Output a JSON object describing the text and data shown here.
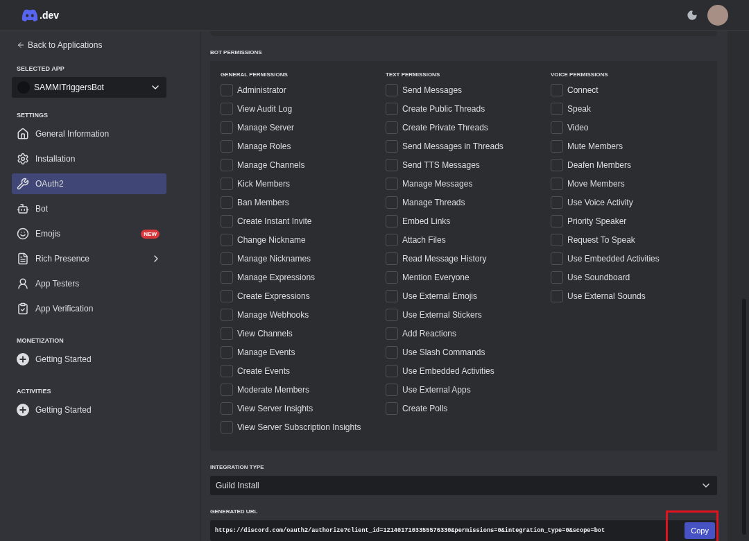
{
  "header": {
    "logo_text": ".dev"
  },
  "sidebar": {
    "back_link": "Back to Applications",
    "selected_app_label": "SELECTED APP",
    "selected_app": "SAMMITriggersBot",
    "sections": [
      {
        "title": "SETTINGS",
        "items": [
          {
            "label": "General Information",
            "selected": false,
            "submenu": false
          },
          {
            "label": "Installation",
            "selected": false,
            "submenu": false
          },
          {
            "label": "OAuth2",
            "selected": true,
            "submenu": false
          },
          {
            "label": "Bot",
            "selected": false,
            "submenu": false
          },
          {
            "label": "Emojis",
            "selected": false,
            "submenu": false,
            "badge": "NEW"
          },
          {
            "label": "Rich Presence",
            "selected": false,
            "submenu": true
          },
          {
            "label": "App Testers",
            "selected": false,
            "submenu": false
          },
          {
            "label": "App Verification",
            "selected": false,
            "submenu": false
          }
        ]
      },
      {
        "title": "MONETIZATION",
        "items": [
          {
            "label": "Getting Started",
            "selected": false,
            "submenu": false
          }
        ]
      },
      {
        "title": "ACTIVITIES",
        "items": [
          {
            "label": "Getting Started",
            "selected": false,
            "submenu": false
          }
        ]
      }
    ]
  },
  "bot_permissions": {
    "title": "BOT PERMISSIONS",
    "groups": [
      {
        "title": "GENERAL PERMISSIONS",
        "items": [
          {
            "label": "Administrator",
            "checked": false
          },
          {
            "label": "View Audit Log",
            "checked": false
          },
          {
            "label": "Manage Server",
            "checked": false
          },
          {
            "label": "Manage Roles",
            "checked": false
          },
          {
            "label": "Manage Channels",
            "checked": false
          },
          {
            "label": "Kick Members",
            "checked": false
          },
          {
            "label": "Ban Members",
            "checked": false
          },
          {
            "label": "Create Instant Invite",
            "checked": false
          },
          {
            "label": "Change Nickname",
            "checked": false
          },
          {
            "label": "Manage Nicknames",
            "checked": false
          },
          {
            "label": "Manage Expressions",
            "checked": false
          },
          {
            "label": "Create Expressions",
            "checked": false
          },
          {
            "label": "Manage Webhooks",
            "checked": false
          },
          {
            "label": "View Channels",
            "checked": false
          },
          {
            "label": "Manage Events",
            "checked": false
          },
          {
            "label": "Create Events",
            "checked": false
          },
          {
            "label": "Moderate Members",
            "checked": false
          },
          {
            "label": "View Server Insights",
            "checked": false
          },
          {
            "label": "View Server Subscription Insights",
            "checked": false
          }
        ]
      },
      {
        "title": "TEXT PERMISSIONS",
        "items": [
          {
            "label": "Send Messages",
            "checked": false
          },
          {
            "label": "Create Public Threads",
            "checked": false
          },
          {
            "label": "Create Private Threads",
            "checked": false
          },
          {
            "label": "Send Messages in Threads",
            "checked": false
          },
          {
            "label": "Send TTS Messages",
            "checked": false
          },
          {
            "label": "Manage Messages",
            "checked": false
          },
          {
            "label": "Manage Threads",
            "checked": false
          },
          {
            "label": "Embed Links",
            "checked": false
          },
          {
            "label": "Attach Files",
            "checked": false
          },
          {
            "label": "Read Message History",
            "checked": false
          },
          {
            "label": "Mention Everyone",
            "checked": false
          },
          {
            "label": "Use External Emojis",
            "checked": false
          },
          {
            "label": "Use External Stickers",
            "checked": false
          },
          {
            "label": "Add Reactions",
            "checked": false
          },
          {
            "label": "Use Slash Commands",
            "checked": false
          },
          {
            "label": "Use Embedded Activities",
            "checked": false
          },
          {
            "label": "Use External Apps",
            "checked": false
          },
          {
            "label": "Create Polls",
            "checked": false
          }
        ]
      },
      {
        "title": "VOICE PERMISSIONS",
        "items": [
          {
            "label": "Connect",
            "checked": false
          },
          {
            "label": "Speak",
            "checked": false
          },
          {
            "label": "Video",
            "checked": false
          },
          {
            "label": "Mute Members",
            "checked": false
          },
          {
            "label": "Deafen Members",
            "checked": false
          },
          {
            "label": "Move Members",
            "checked": false
          },
          {
            "label": "Use Voice Activity",
            "checked": false
          },
          {
            "label": "Priority Speaker",
            "checked": false
          },
          {
            "label": "Request To Speak",
            "checked": false
          },
          {
            "label": "Use Embedded Activities",
            "checked": false
          },
          {
            "label": "Use Soundboard",
            "checked": false
          },
          {
            "label": "Use External Sounds",
            "checked": false
          }
        ]
      }
    ]
  },
  "integration_type": {
    "label": "INTEGRATION TYPE",
    "value": "Guild Install"
  },
  "generated_url": {
    "label": "GENERATED URL",
    "value": "https://discord.com/oauth2/authorize?client_id=1214017103355576330&permissions=0&integration_type=0&scope=bot",
    "copy_button": "Copy",
    "highlighted": true
  }
}
